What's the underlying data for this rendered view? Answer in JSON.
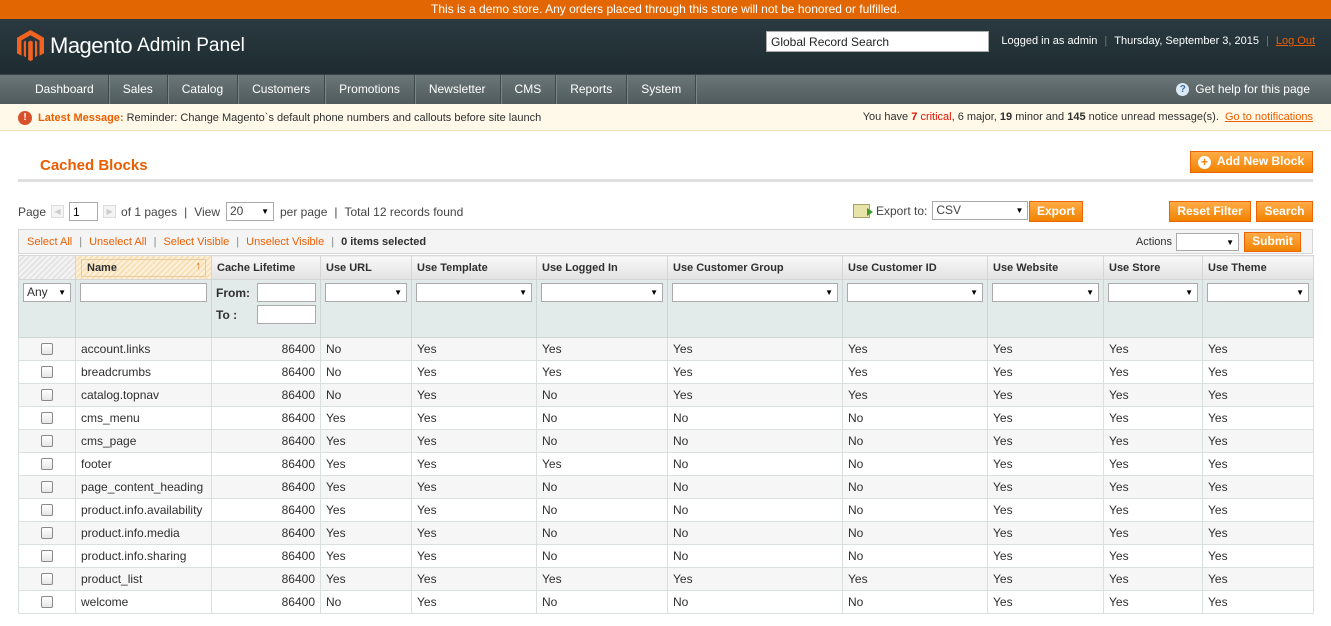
{
  "demo_notice": "This is a demo store. Any orders placed through this store will not be honored or fulfilled.",
  "header": {
    "logo_text": "Magento",
    "logo_sub": "Admin Panel",
    "search_value": "Global Record Search",
    "logged_in": "Logged in as admin",
    "date": "Thursday, September 3, 2015",
    "logout": "Log Out"
  },
  "nav": {
    "items": [
      "Dashboard",
      "Sales",
      "Catalog",
      "Customers",
      "Promotions",
      "Newsletter",
      "CMS",
      "Reports",
      "System"
    ],
    "help": "Get help for this page"
  },
  "message": {
    "label": "Latest Message:",
    "text": "Reminder: Change Magento`s default phone numbers and callouts before site launch",
    "summary_prefix": "You have",
    "critical_count": "7",
    "critical_label": "critical",
    "major": ", 6 major,",
    "minor_count": "19",
    "minor_label": "minor and",
    "notice_count": "145",
    "notice_label": "notice unread message(s).",
    "link": "Go to notifications"
  },
  "page": {
    "title": "Cached Blocks",
    "add_button": "Add New Block"
  },
  "pager": {
    "page_label": "Page",
    "page_value": "1",
    "of_pages": "of 1 pages",
    "view_label": "View",
    "per_page_value": "20",
    "per_page_label": "per page",
    "total": "Total 12 records found"
  },
  "export": {
    "label": "Export to:",
    "format": "CSV",
    "button": "Export"
  },
  "buttons": {
    "reset": "Reset Filter",
    "search": "Search",
    "submit": "Submit"
  },
  "massaction": {
    "select_all": "Select All",
    "unselect_all": "Unselect All",
    "select_visible": "Select Visible",
    "unselect_visible": "Unselect Visible",
    "selected": "0 items selected",
    "actions_label": "Actions"
  },
  "grid": {
    "columns": [
      "Name",
      "Cache Lifetime",
      "Use URL",
      "Use Template",
      "Use Logged In",
      "Use Customer Group",
      "Use Customer ID",
      "Use Website",
      "Use Store",
      "Use Theme"
    ],
    "filter": {
      "any": "Any",
      "from": "From:",
      "to": "To :"
    },
    "rows": [
      [
        "account.links",
        "86400",
        "No",
        "Yes",
        "Yes",
        "Yes",
        "Yes",
        "Yes",
        "Yes",
        "Yes"
      ],
      [
        "breadcrumbs",
        "86400",
        "No",
        "Yes",
        "Yes",
        "Yes",
        "Yes",
        "Yes",
        "Yes",
        "Yes"
      ],
      [
        "catalog.topnav",
        "86400",
        "No",
        "Yes",
        "No",
        "Yes",
        "Yes",
        "Yes",
        "Yes",
        "Yes"
      ],
      [
        "cms_menu",
        "86400",
        "Yes",
        "Yes",
        "No",
        "No",
        "No",
        "Yes",
        "Yes",
        "Yes"
      ],
      [
        "cms_page",
        "86400",
        "Yes",
        "Yes",
        "No",
        "No",
        "No",
        "Yes",
        "Yes",
        "Yes"
      ],
      [
        "footer",
        "86400",
        "Yes",
        "Yes",
        "Yes",
        "No",
        "No",
        "Yes",
        "Yes",
        "Yes"
      ],
      [
        "page_content_heading",
        "86400",
        "Yes",
        "Yes",
        "No",
        "No",
        "No",
        "Yes",
        "Yes",
        "Yes"
      ],
      [
        "product.info.availability",
        "86400",
        "Yes",
        "Yes",
        "No",
        "No",
        "No",
        "Yes",
        "Yes",
        "Yes"
      ],
      [
        "product.info.media",
        "86400",
        "Yes",
        "Yes",
        "No",
        "No",
        "No",
        "Yes",
        "Yes",
        "Yes"
      ],
      [
        "product.info.sharing",
        "86400",
        "Yes",
        "Yes",
        "No",
        "No",
        "No",
        "Yes",
        "Yes",
        "Yes"
      ],
      [
        "product_list",
        "86400",
        "Yes",
        "Yes",
        "Yes",
        "Yes",
        "Yes",
        "Yes",
        "Yes",
        "Yes"
      ],
      [
        "welcome",
        "86400",
        "No",
        "Yes",
        "No",
        "No",
        "No",
        "Yes",
        "Yes",
        "Yes"
      ]
    ]
  }
}
